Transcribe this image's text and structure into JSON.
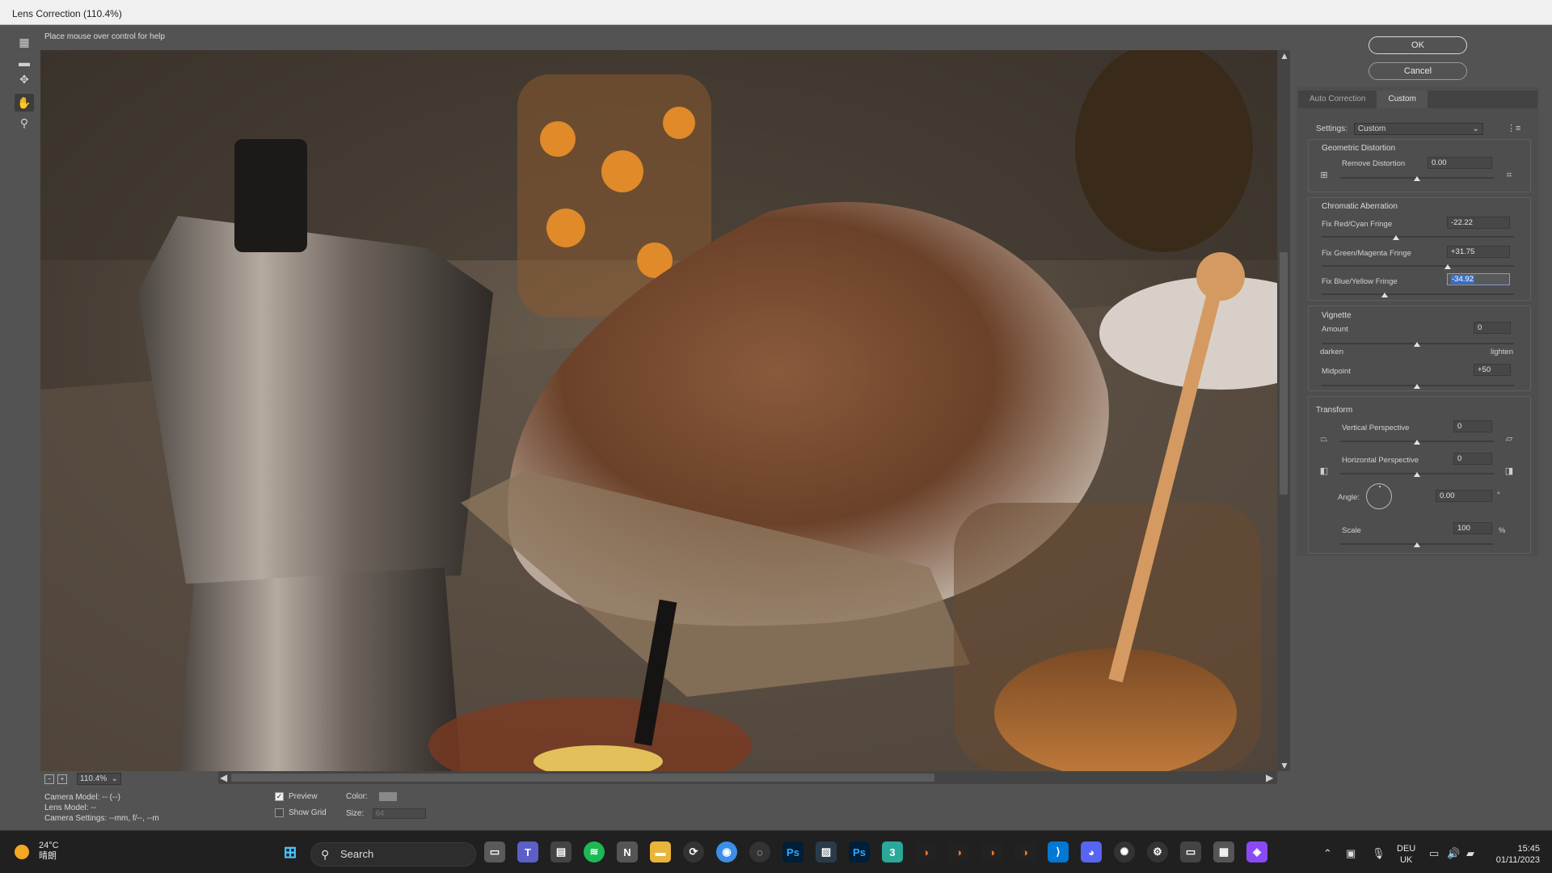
{
  "window": {
    "title": "Lens Correction (110.4%)"
  },
  "hint": "Place mouse over control for help",
  "buttons": {
    "ok": "OK",
    "cancel": "Cancel"
  },
  "tabs": [
    {
      "label": "Auto Correction"
    },
    {
      "label": "Custom"
    }
  ],
  "settings": {
    "label": "Settings:",
    "value": "Custom"
  },
  "geometric": {
    "title": "Geometric Distortion",
    "remove_label": "Remove Distortion",
    "remove_value": "0.00"
  },
  "chromatic": {
    "title": "Chromatic Aberration",
    "red_label": "Fix Red/Cyan Fringe",
    "red_value": "-22.22",
    "green_label": "Fix Green/Magenta Fringe",
    "green_value": "+31.75",
    "blue_label": "Fix Blue/Yellow Fringe",
    "blue_value": "-34.92"
  },
  "vignette": {
    "title": "Vignette",
    "amount_label": "Amount",
    "amount_value": "0",
    "darken": "darken",
    "lighten": "lighten",
    "midpoint_label": "Midpoint",
    "midpoint_value": "+50"
  },
  "transform": {
    "title": "Transform",
    "vertical_label": "Vertical Perspective",
    "vertical_value": "0",
    "horizontal_label": "Horizontal Perspective",
    "horizontal_value": "0",
    "angle_label": "Angle:",
    "angle_value": "0.00",
    "angle_unit": "°",
    "scale_label": "Scale",
    "scale_value": "100",
    "scale_unit": "%"
  },
  "zoom": {
    "value": "110.4%"
  },
  "camera": {
    "model": "Camera Model: -- (--)",
    "lens": "Lens Model: --",
    "settings": "Camera Settings: --mm, f/--, --m"
  },
  "bottom": {
    "preview_label": "Preview",
    "show_grid_label": "Show Grid",
    "color_label": "Color:",
    "size_label": "Size:",
    "size_value": "64"
  },
  "taskbar": {
    "weather_temp": "24°C",
    "weather_desc": "晴朗",
    "search_placeholder": "Search",
    "lang_top": "DEU",
    "lang_bottom": "UK",
    "time": "15:45",
    "date": "01/11/2023"
  },
  "colors": {
    "accent": "#3b6fc7",
    "panel": "#535353",
    "taskbar": "#202020"
  }
}
